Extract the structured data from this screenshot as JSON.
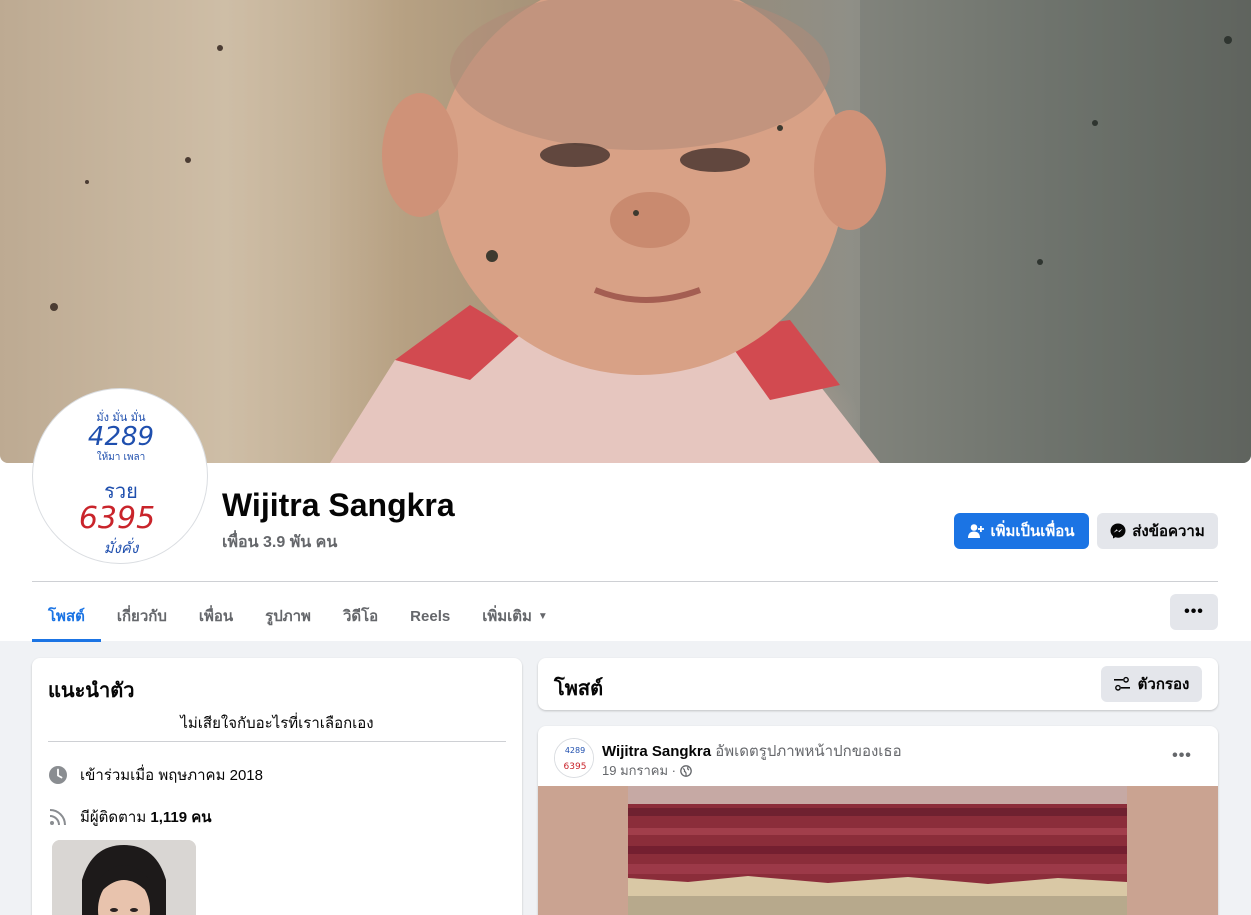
{
  "profile": {
    "name": "Wijitra Sangkra",
    "friends": "เพื่อน 3.9 พัน คน",
    "avatar_texts": {
      "top_small": "มั่ง มั่น มั่น",
      "number_blue": "4289",
      "line_small": "ให้มา เพลา",
      "word_blue": "รวย",
      "number_red": "6395",
      "bottom_blue": "มั่งคั่ง"
    }
  },
  "actions": {
    "add_friend": "เพิ่มเป็นเพื่อน",
    "message": "ส่งข้อความ",
    "more": "•••"
  },
  "tabs": [
    {
      "label": "โพสต์",
      "active": true
    },
    {
      "label": "เกี่ยวกับ"
    },
    {
      "label": "เพื่อน"
    },
    {
      "label": "รูปภาพ"
    },
    {
      "label": "วิดีโอ"
    },
    {
      "label": "Reels"
    },
    {
      "label": "เพิ่มเติม"
    }
  ],
  "intro": {
    "title": "แนะนำตัว",
    "bio": "ไม่เสียใจกับอะไรที่เราเลือกเอง",
    "joined": "เข้าร่วมเมื่อ พฤษภาคม 2018",
    "followers_prefix": "มีผู้ติดตาม",
    "followers_count": "1,119 คน"
  },
  "posts_header": {
    "title": "โพสต์",
    "filter": "ตัวกรอง"
  },
  "post": {
    "author": "Wijitra Sangkra",
    "action": "อัพเดตรูปภาพหน้าปกของเธอ",
    "date": "19 มกราคม ·",
    "more": "•••"
  },
  "colors": {
    "primary": "#1b74e4",
    "secondary_button": "#e4e6eb",
    "background": "#f0f2f5",
    "muted_text": "#65676b"
  }
}
